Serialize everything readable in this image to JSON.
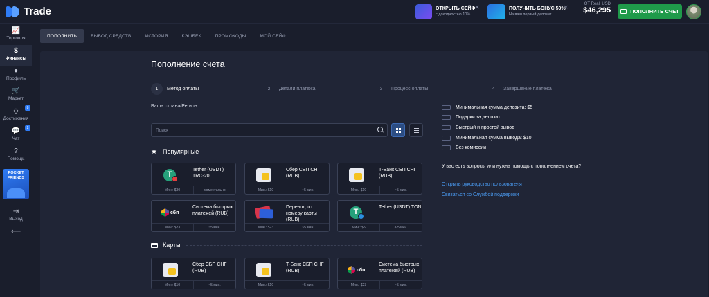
{
  "header": {
    "logo_text": "Trade",
    "promos": [
      {
        "title": "ОТКРЫТЬ СЕЙФ",
        "subtitle": "с доходностью 10%"
      },
      {
        "title": "ПОЛУЧИТЬ БОНУС 50%",
        "subtitle": "На ваш первый депозит"
      }
    ],
    "account_type": "QT Real",
    "currency": "USD",
    "balance": "$46,295",
    "deposit_button": "ПОПОЛНИТЬ СЧЕТ"
  },
  "sidebar": {
    "items": [
      {
        "label": "Торговля",
        "icon": "chart-icon"
      },
      {
        "label": "Финансы",
        "icon": "dollar-icon"
      },
      {
        "label": "Профиль",
        "icon": "user-icon"
      },
      {
        "label": "Маркет",
        "icon": "cart-icon"
      },
      {
        "label": "Достижения",
        "icon": "diamond-icon",
        "badge": "8"
      },
      {
        "label": "Чат",
        "icon": "chat-icon",
        "badge": "2"
      },
      {
        "label": "Помощь",
        "icon": "help-icon"
      },
      {
        "label": "Выход",
        "icon": "logout-icon"
      }
    ],
    "pocket_friends": "POCKET FRIENDS"
  },
  "tabs": [
    "ПОПОЛНИТЬ",
    "ВЫВОД СРЕДСТВ",
    "ИСТОРИЯ",
    "КЭШБЕК",
    "ПРОМОКОДЫ",
    "МОЙ СЕЙФ"
  ],
  "page_title": "Пополнение счета",
  "steps": [
    {
      "num": "1",
      "label": "Метод оплаты"
    },
    {
      "num": "2",
      "label": "Детали платежа"
    },
    {
      "num": "3",
      "label": "Процесс оплаты"
    },
    {
      "num": "4",
      "label": "Завершение платежа"
    }
  ],
  "region_label": "Ваша страна/Регион",
  "search": {
    "placeholder": "Поиск"
  },
  "sections": {
    "popular": "Популярные",
    "cards": "Карты"
  },
  "popular_methods": [
    {
      "name": "Tether (USDT) TRC-20",
      "min": "Мин.: $30",
      "time": "моментально"
    },
    {
      "name": "Сбер СБП СНГ (RUB)",
      "min": "Мин.: $10",
      "time": "~5 мин."
    },
    {
      "name": "Т-Банк СБП СНГ (RUB)",
      "min": "Мин.: $10",
      "time": "~5 мин."
    },
    {
      "name": "Система быстрых платежей (RUB)",
      "min": "Мин.: $23",
      "time": "~5 мин."
    },
    {
      "name": "Перевод по номеру карты (RUB)",
      "min": "Мин.: $23",
      "time": "~5 мин."
    },
    {
      "name": "Tether (USDT) TON",
      "min": "Мин.: $5",
      "time": "3-5 мин."
    }
  ],
  "card_methods": [
    {
      "name": "Сбер СБП СНГ (RUB)",
      "min": "Мин.: $10",
      "time": "~5 мин."
    },
    {
      "name": "Т-Банк СБП СНГ (RUB)",
      "min": "Мин.: $10",
      "time": "~5 мин."
    },
    {
      "name": "Система быстрых платежей (RUB)",
      "min": "Мин.: $23",
      "time": "~5 мин."
    }
  ],
  "sbp_text": "сбп",
  "info": [
    "Минимальная сумма депозита: $5",
    "Подарки за депозит",
    "Быстрый и простой вывод",
    "Минимальная сумма вывода: $10",
    "Без комиссии"
  ],
  "help": {
    "question": "У вас есть вопросы или нужна помощь с пополнением счета?",
    "guide_link": "Открыть руководство пользователя",
    "support_link": "Связаться со Службой поддержки"
  },
  "colors": {
    "accent": "#2f7cf6",
    "deposit_green": "#1f9a4a",
    "link": "#4a9af0"
  }
}
